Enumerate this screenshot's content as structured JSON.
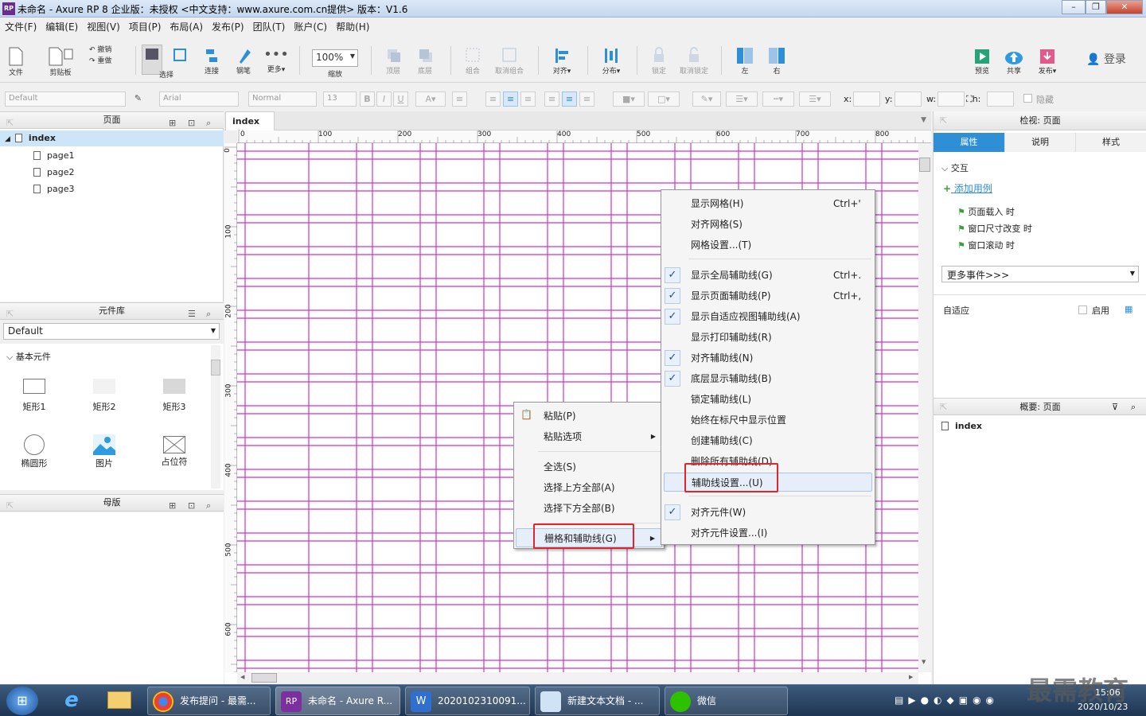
{
  "window": {
    "title": "未命名 - Axure RP 8 企业版：未授权    <中文支持：www.axure.com.cn提供> 版本：V1.6",
    "logo": "RP"
  },
  "menubar": [
    "文件(F)",
    "编辑(E)",
    "视图(V)",
    "项目(P)",
    "布局(A)",
    "发布(P)",
    "团队(T)",
    "账户(C)",
    "帮助(H)"
  ],
  "toolbar": {
    "file": "文件",
    "clipboard": "剪贴板",
    "undo": "撤销",
    "redo": "重做",
    "select": "选择",
    "connect": "连接",
    "pen": "钢笔",
    "more": "更多▾",
    "zoom": "100%",
    "zoom_label": "缩放",
    "top": "顶层",
    "bottom": "底层",
    "group": "组合",
    "ungroup": "取消组合",
    "align": "对齐▾",
    "distribute": "分布▾",
    "lock": "锁定",
    "unlock": "取消锁定",
    "left": "左",
    "right": "右",
    "preview": "预览",
    "share": "共享",
    "publish": "发布▾",
    "login": "登录"
  },
  "format": {
    "style": "Default",
    "font": "Arial",
    "weight": "Normal",
    "size": "13",
    "x": "x:",
    "y": "y:",
    "w": "w:",
    "h": "h:",
    "hide": "隐藏"
  },
  "pages_panel": {
    "title": "页面",
    "root": "index",
    "children": [
      "page1",
      "page2",
      "page3"
    ]
  },
  "library_panel": {
    "title": "元件库",
    "library": "Default",
    "category": "基本元件",
    "items": [
      "矩形1",
      "矩形2",
      "矩形3",
      "椭圆形",
      "图片",
      "占位符"
    ]
  },
  "masters_panel": {
    "title": "母版"
  },
  "canvas": {
    "tab": "index",
    "ruler_h": [
      "0",
      "100",
      "200",
      "300",
      "400",
      "500",
      "600",
      "700",
      "800"
    ],
    "ruler_v": [
      "0",
      "100",
      "200",
      "300",
      "400",
      "500",
      "600"
    ]
  },
  "right_panel": {
    "title": "检视: 页面",
    "tabs": [
      "属性",
      "说明",
      "样式"
    ],
    "interaction": "交互",
    "add_case": "添加用例",
    "events": [
      "页面载入 时",
      "窗口尺寸改变 时",
      "窗口滚动 时"
    ],
    "more_events": "更多事件>>>",
    "adaptive": "自适应",
    "enable": "启用",
    "outline_title": "概要: 页面",
    "outline_item": "index"
  },
  "context_menu": {
    "items": [
      "粘贴(P)",
      "粘贴选项",
      "全选(S)",
      "选择上方全部(A)",
      "选择下方全部(B)",
      "栅格和辅助线(G)"
    ]
  },
  "submenu": {
    "items": [
      {
        "label": "显示网格(H)",
        "shortcut": "Ctrl+'"
      },
      {
        "label": "对齐网格(S)",
        "shortcut": ""
      },
      {
        "label": "网格设置...(T)",
        "shortcut": ""
      },
      {
        "label": "显示全局辅助线(G)",
        "shortcut": "Ctrl+."
      },
      {
        "label": "显示页面辅助线(P)",
        "shortcut": "Ctrl+,"
      },
      {
        "label": "显示自适应视图辅助线(A)",
        "shortcut": ""
      },
      {
        "label": "显示打印辅助线(R)",
        "shortcut": ""
      },
      {
        "label": "对齐辅助线(N)",
        "shortcut": ""
      },
      {
        "label": "底层显示辅助线(B)",
        "shortcut": ""
      },
      {
        "label": "锁定辅助线(L)",
        "shortcut": ""
      },
      {
        "label": "始终在标尺中显示位置",
        "shortcut": ""
      },
      {
        "label": "创建辅助线(C)",
        "shortcut": ""
      },
      {
        "label": "删除所有辅助线(D)",
        "shortcut": ""
      },
      {
        "label": "辅助线设置...(U)",
        "shortcut": ""
      },
      {
        "label": "对齐元件(W)",
        "shortcut": ""
      },
      {
        "label": "对齐元件设置...(I)",
        "shortcut": ""
      }
    ]
  },
  "taskbar": {
    "tasks": [
      "发布提问 - 最需...",
      "未命名 - Axure R...",
      "2020102310091...",
      "新建文本文档 - ...",
      "微信"
    ],
    "time": "15:06",
    "date": "2020/10/23",
    "watermark": "最需教育"
  },
  "colors": {
    "grid": "#cc33cc",
    "accent": "#2e8fd6",
    "highlight": "#e0262c"
  }
}
